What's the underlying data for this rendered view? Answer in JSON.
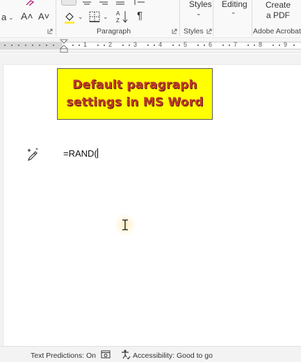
{
  "ribbon": {
    "styles_button": "Styles",
    "editing_button": "Editing",
    "create_pdf_line1": "Create",
    "create_pdf_line2": "a PDF",
    "paragraph_group": "Paragraph",
    "styles_group": "Styles",
    "acrobat_group": "Adobe Acrobat",
    "sort_glyph": "A↓Z",
    "pilcrow": "¶",
    "grow_font": "A˄",
    "shrink_font": "A˅",
    "partial_a": "a"
  },
  "ruler": {
    "numbers": [
      "1",
      "2",
      "3",
      "4",
      "5",
      "6",
      "7",
      "8",
      "9"
    ]
  },
  "document": {
    "title_line1": "Default paragraph",
    "title_line2": "settings in MS Word",
    "formula_text": "=RAND("
  },
  "statusbar": {
    "text_predictions": "Text Predictions: On",
    "accessibility": "Accessibility: Good to go"
  },
  "colors": {
    "title_fill": "#ffff00",
    "title_text": "#c0392b"
  }
}
